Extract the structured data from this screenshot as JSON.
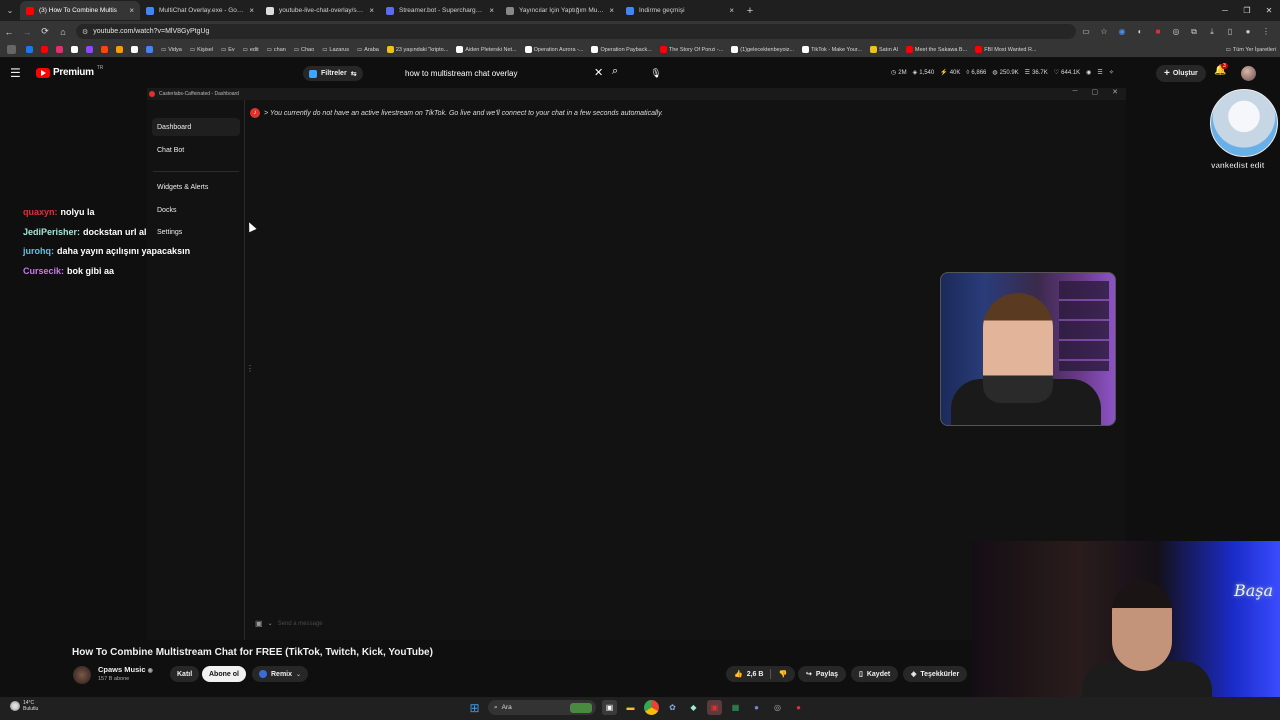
{
  "browser": {
    "tabs": [
      {
        "title": "(3) How To Combine Multis",
        "color": "#ff0000",
        "active": true
      },
      {
        "title": "MultiChat Overlay.exe - Google",
        "color": "#4285f4",
        "active": false
      },
      {
        "title": "youtube-live-chat-overlay/style",
        "color": "#dddddd",
        "active": false
      },
      {
        "title": "Streamer.bot - Supercharge yo",
        "color": "#5b6cf0",
        "active": false
      },
      {
        "title": "Yayıncılar İçin Yaptığım MultiCh",
        "color": "#888888",
        "active": false
      },
      {
        "title": "İndirme geçmişi",
        "color": "#4285f4",
        "active": false
      }
    ],
    "url": "youtube.com/watch?v=MlV8GyPtgUg",
    "bookmarks": [
      {
        "label": "",
        "color": "#1877f2"
      },
      {
        "label": "",
        "color": "#ff0000"
      },
      {
        "label": "",
        "color": "#e1306c"
      },
      {
        "label": "",
        "color": "#ffffff"
      },
      {
        "label": "",
        "color": "#9146ff"
      },
      {
        "label": "",
        "color": "#ff4500"
      },
      {
        "label": "",
        "color": "#ff9900"
      },
      {
        "label": "",
        "color": "#ffffff"
      },
      {
        "label": "",
        "color": "#4285f4"
      },
      {
        "label": "Vidya",
        "color": "#d8d8d8"
      },
      {
        "label": "Kişisel",
        "color": "#d8d8d8"
      },
      {
        "label": "Ev",
        "color": "#d8d8d8"
      },
      {
        "label": "edit",
        "color": "#d8d8d8"
      },
      {
        "label": "chan",
        "color": "#d8d8d8"
      },
      {
        "label": "Chao",
        "color": "#d8d8d8"
      },
      {
        "label": "Lazarus",
        "color": "#d8d8d8"
      },
      {
        "label": "Araba",
        "color": "#d8d8d8"
      },
      {
        "label": "23 yaşındaki \"kripto...",
        "color": "#f0c020"
      },
      {
        "label": "Aiden Pleterski Net...",
        "color": "#ffffff"
      },
      {
        "label": "Operation Aurora -...",
        "color": "#ffffff"
      },
      {
        "label": "Operation Payback...",
        "color": "#ffffff"
      },
      {
        "label": "The Story Of Ponzi -...",
        "color": "#ff0000"
      },
      {
        "label": "(1)gelecektenbeyoiz...",
        "color": "#ffffff"
      },
      {
        "label": "TikTok - Make Your...",
        "color": "#ffffff"
      },
      {
        "label": "Satın Al",
        "color": "#f0c020"
      },
      {
        "label": "Meet the Sakawa B...",
        "color": "#ff0000"
      },
      {
        "label": "FBI Most Wanted R...",
        "color": "#ff0000"
      }
    ],
    "all_bookmarks_label": "Tüm Yer İşaretleri"
  },
  "youtube_header": {
    "brand": "Premium",
    "region": "TR",
    "filters_label": "Filtreler",
    "search_value": "how to multistream chat overlay",
    "stats": [
      "2M",
      "1,540",
      "40K",
      "6,866",
      "250.9K",
      "36.7K",
      "644.1K"
    ],
    "create_label": "Oluştur",
    "notif_count": "3"
  },
  "caffeinated": {
    "window_title": "Casterlabs-Caffeinated - Dashboard",
    "sidebar": [
      {
        "label": "Dashboard",
        "active": true
      },
      {
        "label": "Chat Bot",
        "active": false
      },
      {
        "label": "Widgets & Alerts",
        "active": false
      },
      {
        "label": "Docks",
        "active": false
      },
      {
        "label": "Settings",
        "active": false
      }
    ],
    "notice": "> You currently do not have an active livestream on TikTok. Go live and we'll connect to your chat in a few seconds automatically.",
    "send_placeholder": "Send a message"
  },
  "chat": [
    {
      "user": "quaxyn:",
      "message": "nolyu la",
      "color": "#e0303a"
    },
    {
      "user": "JediPerisher:",
      "message": "dockstan url al",
      "color": "#9fe8d8"
    },
    {
      "user": "jurohq:",
      "message": "daha yayın açılışını yapacaksın",
      "color": "#4fc8e0"
    },
    {
      "user": "Cursecik:",
      "message": "bok gibi aa",
      "color": "#c87ae8"
    }
  ],
  "overlay": {
    "cat_label": "vankedist edit",
    "neon_sign": "Başa"
  },
  "video": {
    "title": "How To Combine Multistream Chat for FREE (TikTok, Twitch, Kick, YouTube)",
    "channel": "Cpaws Music",
    "subscribers": "157 B abone",
    "join_label": "Katıl",
    "subscribe_label": "Abone ol",
    "remix_label": "Remix",
    "likes": "2,6 B",
    "share_label": "Paylaş",
    "save_label": "Kaydet",
    "thanks_label": "Teşekkürler"
  },
  "taskbar": {
    "temp": "14°C",
    "weather": "Bulutlu",
    "search_label": "Ara"
  }
}
